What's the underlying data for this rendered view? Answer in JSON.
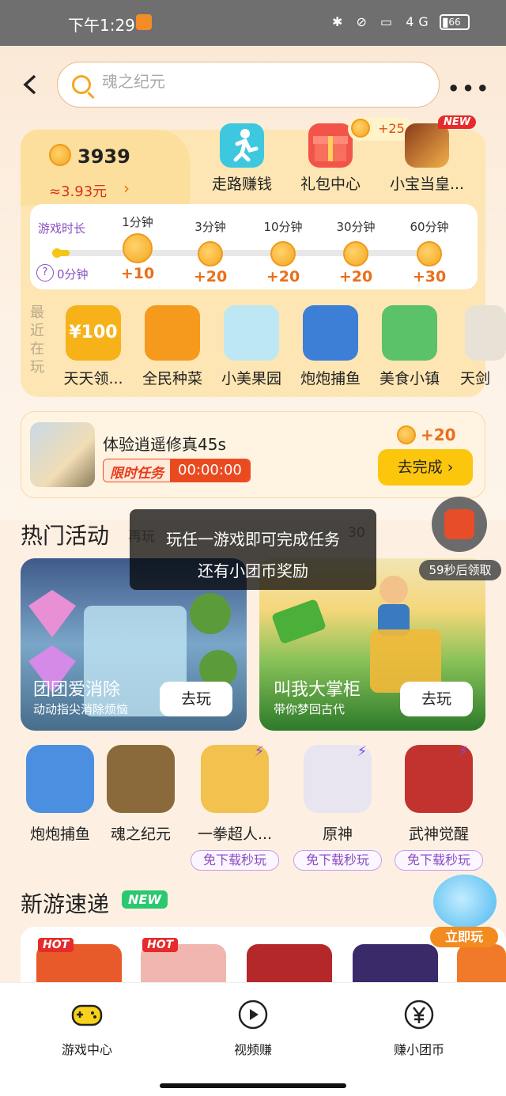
{
  "status_bar": {
    "time": "下午1:29",
    "network": "4G",
    "battery": "66"
  },
  "search": {
    "placeholder": "魂之纪元"
  },
  "coins": {
    "balance": "3939",
    "cny": "≈3.93元",
    "chevron": "›"
  },
  "quick_actions": [
    {
      "label": "走路赚钱",
      "icon": "running-person-icon"
    },
    {
      "label": "礼包中心",
      "icon": "gift-box-icon",
      "bonus": "+25"
    },
    {
      "label": "小宝当皇...",
      "icon": "game-cover-icon",
      "badge": "NEW"
    }
  ],
  "playtime": {
    "title": "游戏时长",
    "current": "0分钟",
    "help": "?",
    "steps": [
      {
        "label": "1分钟",
        "reward": "+10"
      },
      {
        "label": "3分钟",
        "reward": "+20"
      },
      {
        "label": "10分钟",
        "reward": "+20"
      },
      {
        "label": "30分钟",
        "reward": "+20"
      },
      {
        "label": "60分钟",
        "reward": "+30"
      }
    ]
  },
  "recent": {
    "label": "最近在玩",
    "items": [
      {
        "name": "天天领...",
        "color": "#f7b21a",
        "text": "¥100"
      },
      {
        "name": "全民种菜",
        "color": "#f59a1d",
        "text": ""
      },
      {
        "name": "小美果园",
        "color": "#bde8f3",
        "text": ""
      },
      {
        "name": "炮炮捕鱼",
        "color": "#3d7fd6",
        "text": ""
      },
      {
        "name": "美食小镇",
        "color": "#5bc26a",
        "text": ""
      },
      {
        "name": "天剑",
        "color": "#e8e2d6",
        "text": ""
      }
    ]
  },
  "task": {
    "title": "体验逍遥修真45s",
    "limit_label": "限时任务",
    "timer": "00:00:00",
    "reward": "+20",
    "button": "去完成 ›"
  },
  "hot": {
    "title": "热门活动",
    "hint": "再玩",
    "hint_tail": "30",
    "cards": [
      {
        "name": "团团爱消除",
        "sub": "动动指尖消除烦恼",
        "button": "去玩"
      },
      {
        "name": "叫我大掌柜",
        "sub": "带你梦回古代",
        "button": "去玩"
      }
    ]
  },
  "toast": {
    "line1": "玩任一游戏即可完成任务",
    "line2": "还有小团币奖励"
  },
  "float_reward": {
    "timer": "59秒后领取"
  },
  "games": [
    {
      "name": "炮炮捕鱼",
      "tag": "",
      "color": "#4a8fe0"
    },
    {
      "name": "魂之纪元",
      "tag": "",
      "color": "#8a6a3a"
    },
    {
      "name": "一拳超人...",
      "tag": "免下载秒玩",
      "color": "#f2c14e"
    },
    {
      "name": "原神",
      "tag": "免下载秒玩",
      "color": "#e8e4f0"
    },
    {
      "name": "武神觉醒",
      "tag": "免下载秒玩",
      "color": "#c2332f"
    }
  ],
  "new_games": {
    "title": "新游速递",
    "badge": "NEW",
    "hot_tag": "HOT",
    "thumbs": [
      "#e85a2a",
      "#f2b6b0",
      "#b4282a",
      "#3a2a6a",
      "#f07a2a"
    ]
  },
  "mascot": {
    "button": "立即玩"
  },
  "nav": [
    {
      "label": "游戏中心",
      "icon": "gamepad-icon"
    },
    {
      "label": "视频赚",
      "icon": "play-video-icon"
    },
    {
      "label": "赚小团币",
      "icon": "yen-coin-icon"
    }
  ]
}
